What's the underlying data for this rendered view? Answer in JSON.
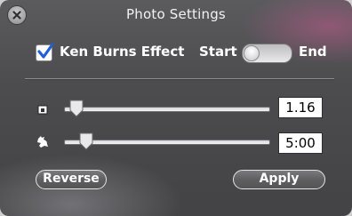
{
  "window": {
    "title": "Photo Settings"
  },
  "ken_burns": {
    "checked": true,
    "label": "Ken Burns Effect",
    "start_label": "Start",
    "end_label": "End",
    "toggle_value": "Start"
  },
  "zoom": {
    "value": "1.16",
    "slider_fraction": 0.03
  },
  "duration": {
    "value": "5:00",
    "slider_fraction": 0.08
  },
  "buttons": {
    "reverse": "Reverse",
    "apply": "Apply"
  },
  "colors": {
    "panel": "#4c4c4f",
    "accent_check": "#1e5fd6",
    "text": "#ffffff",
    "field_bg": "#ffffff"
  },
  "icons": {
    "close": "close-x-icon",
    "zoom_small": "small-picture-icon",
    "zoom_large": "large-picture-icon",
    "speed_fast": "rabbit-icon",
    "speed_slow": "turtle-icon"
  }
}
